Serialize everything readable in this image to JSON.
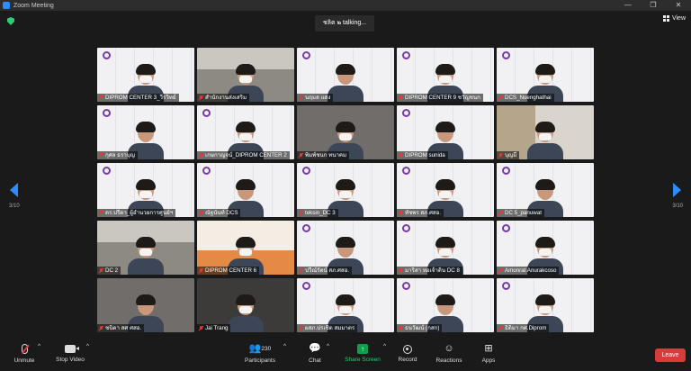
{
  "window": {
    "title": "Zoom Meeting",
    "controls": [
      "—",
      "❐",
      "✕"
    ]
  },
  "header": {
    "talking_indicator": "ชลิต ๒ talking...",
    "view_label": "View"
  },
  "pagination": {
    "left_label": "3/10",
    "right_label": "3/10"
  },
  "colors": {
    "accent": "#2d8cff",
    "leave": "#d93a3a",
    "share": "#0e9f4f",
    "muted": "#e53935"
  },
  "tiles": [
    {
      "name": "DIPROM CENTER 3_วีรวิทย์",
      "bg": "wall"
    },
    {
      "name": "สำนักงานส่งเสริม",
      "bg": "office"
    },
    {
      "name": "นฤมล แสง",
      "bg": "wall"
    },
    {
      "name": "DIPROM CENTER 9 ชวัญชนก",
      "bg": "wall"
    },
    {
      "name": "DCS_Nuenghathai",
      "bg": "wall"
    },
    {
      "name": "กุศล ธราบุญ",
      "bg": "wall"
    },
    {
      "name": "เกษกาญจน์_DIPROM CENTER 2",
      "bg": "wall"
    },
    {
      "name": "พิมพ์ชนก ทนาคม",
      "bg": "dim"
    },
    {
      "name": "DIPROM sunida",
      "bg": "wall"
    },
    {
      "name": "บุญมี",
      "bg": "shelf"
    },
    {
      "name": "ดร.ปรีดา_ผู้อำนวยการศูนย์ฯ",
      "bg": "wall"
    },
    {
      "name": "ณัฐนันท์ DCS",
      "bg": "wall"
    },
    {
      "name": "teksin_DC 3",
      "bg": "wall"
    },
    {
      "name": "ทัชพร สภ.ศสอ.",
      "bg": "wall"
    },
    {
      "name": "DC 5_panuwat",
      "bg": "wall"
    },
    {
      "name": "DC 2",
      "bg": "office"
    },
    {
      "name": "DIPROM CENTER 6",
      "bg": "orange"
    },
    {
      "name": "ปวีณ์รัตน์ สภ.ศสอ.",
      "bg": "wall"
    },
    {
      "name": "มาริสา หอเจ้าดิน DC 8",
      "bg": "wall"
    },
    {
      "name": "Amonrat Anurakcoso",
      "bg": "wall"
    },
    {
      "name": "ชนิดา สศ ศสอ.",
      "bg": "dim"
    },
    {
      "name": "Jai Trang",
      "bg": "dark"
    },
    {
      "name": "ผสภ.ปรเชิด สมมาตร",
      "bg": "wall"
    },
    {
      "name": "ธนวัฒน์ (กสก)",
      "bg": "wall"
    },
    {
      "name": "ธิติมา กศ.Diprom",
      "bg": "wall"
    }
  ],
  "toolbar": {
    "unmute": "Unmute",
    "stop_video": "Stop Video",
    "participants": "Participants",
    "participant_count": "230",
    "chat": "Chat",
    "share_screen": "Share Screen",
    "record": "Record",
    "reactions": "Reactions",
    "apps": "Apps",
    "leave": "Leave"
  }
}
